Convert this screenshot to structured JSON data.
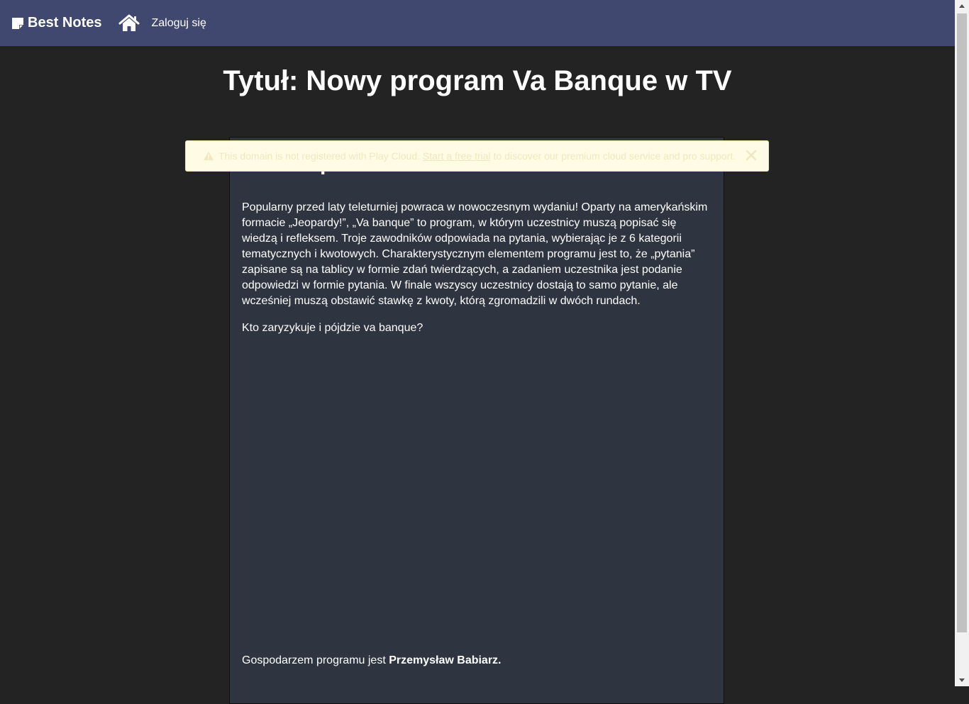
{
  "navbar": {
    "brand_label": "Best Notes",
    "brand_icon": "note-icon",
    "home_icon": "home-icon",
    "login_label": "Zaloguj się",
    "background": "#41486f"
  },
  "page": {
    "title": "Tytuł: Nowy program Va Banque w TV"
  },
  "note": {
    "heading": "Va Banque",
    "paragraph1": "Popularny przed laty teleturniej powraca w nowoczesnym wydaniu! Oparty na amerykańskim formacie „Jeopardy!”, „Va banque” to program, w którym uczestnicy muszą popisać się wiedzą i refleksem. Troje zawodników odpowiada na pytania, wybierając je z 6 kategorii tematycznych i kwotowych. Charakterystycznym elementem programu jest to, że „pytania” zapisane są na tablicy w formie zdań twierdzących, a zadaniem uczestnika jest podanie odpowiedzi w formie pytania. W finale wszyscy uczestnicy dostają to samo pytanie, ale wcześniej muszą obstawić stawkę z kwoty, którą zgromadzili w dwóch rundach.",
    "paragraph2": "Kto zaryzykuje i pójdzie va banque?",
    "host_prefix": "Gospodarzem programu jest ",
    "host_name": "Przemysław Babiarz."
  },
  "banner": {
    "text_before": "This domain is not registered with Play Cloud.",
    "link_label": "Start a free trial",
    "text_after": "to discover our premium cloud service and pro support.",
    "warning_icon": "warning-icon",
    "close_icon": "close-icon",
    "background": "#fffbe5"
  }
}
